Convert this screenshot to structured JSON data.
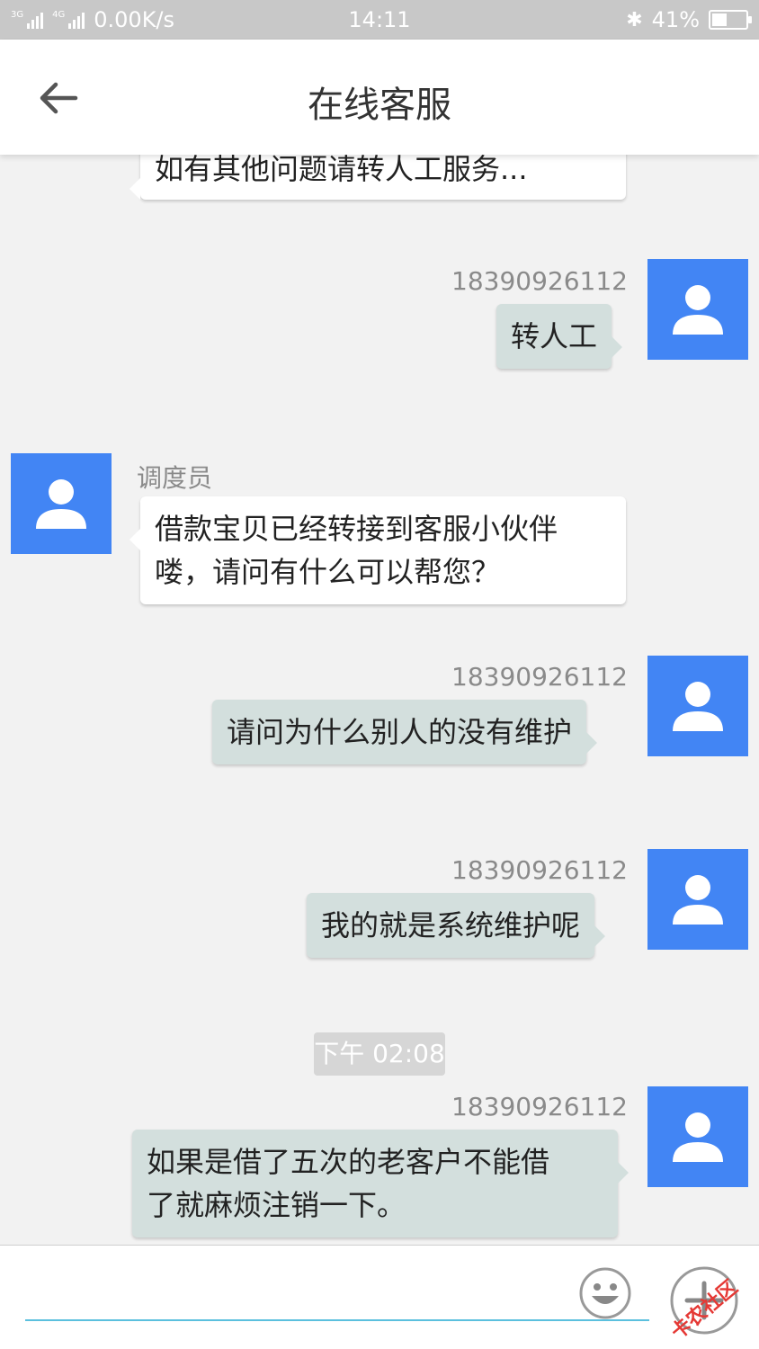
{
  "status_bar": {
    "network_3g": "3G",
    "network_4g": "4G",
    "speed": "0.00K/s",
    "time": "14:11",
    "battery": "41%"
  },
  "header": {
    "title": "在线客服"
  },
  "messages": [
    {
      "side": "left",
      "text": "如有其他问题请转人工服务..."
    },
    {
      "side": "right",
      "sender": "18390926112",
      "text": "转人工"
    },
    {
      "side": "left",
      "sender": "调度员",
      "lines": [
        "借款宝贝已经转接到客服小伙伴",
        "喽，请问有什么可以帮您？"
      ]
    },
    {
      "side": "right",
      "sender": "18390926112",
      "text": "请问为什么别人的没有维护"
    },
    {
      "side": "right",
      "sender": "18390926112",
      "text": "我的就是系统维护呢"
    },
    {
      "side": "right",
      "sender": "18390926112",
      "lines": [
        "如果是借了五次的老客户不能借",
        "了就麻烦注销一下。"
      ]
    }
  ],
  "timestamp": "下午 02:08",
  "input": {
    "value": "",
    "watermark": "卡农社区"
  },
  "colors": {
    "avatar_bg": "#4285f4",
    "outgoing_bubble": "#d3dfdd",
    "incoming_bubble": "#ffffff",
    "input_underline": "#5bc0de"
  }
}
